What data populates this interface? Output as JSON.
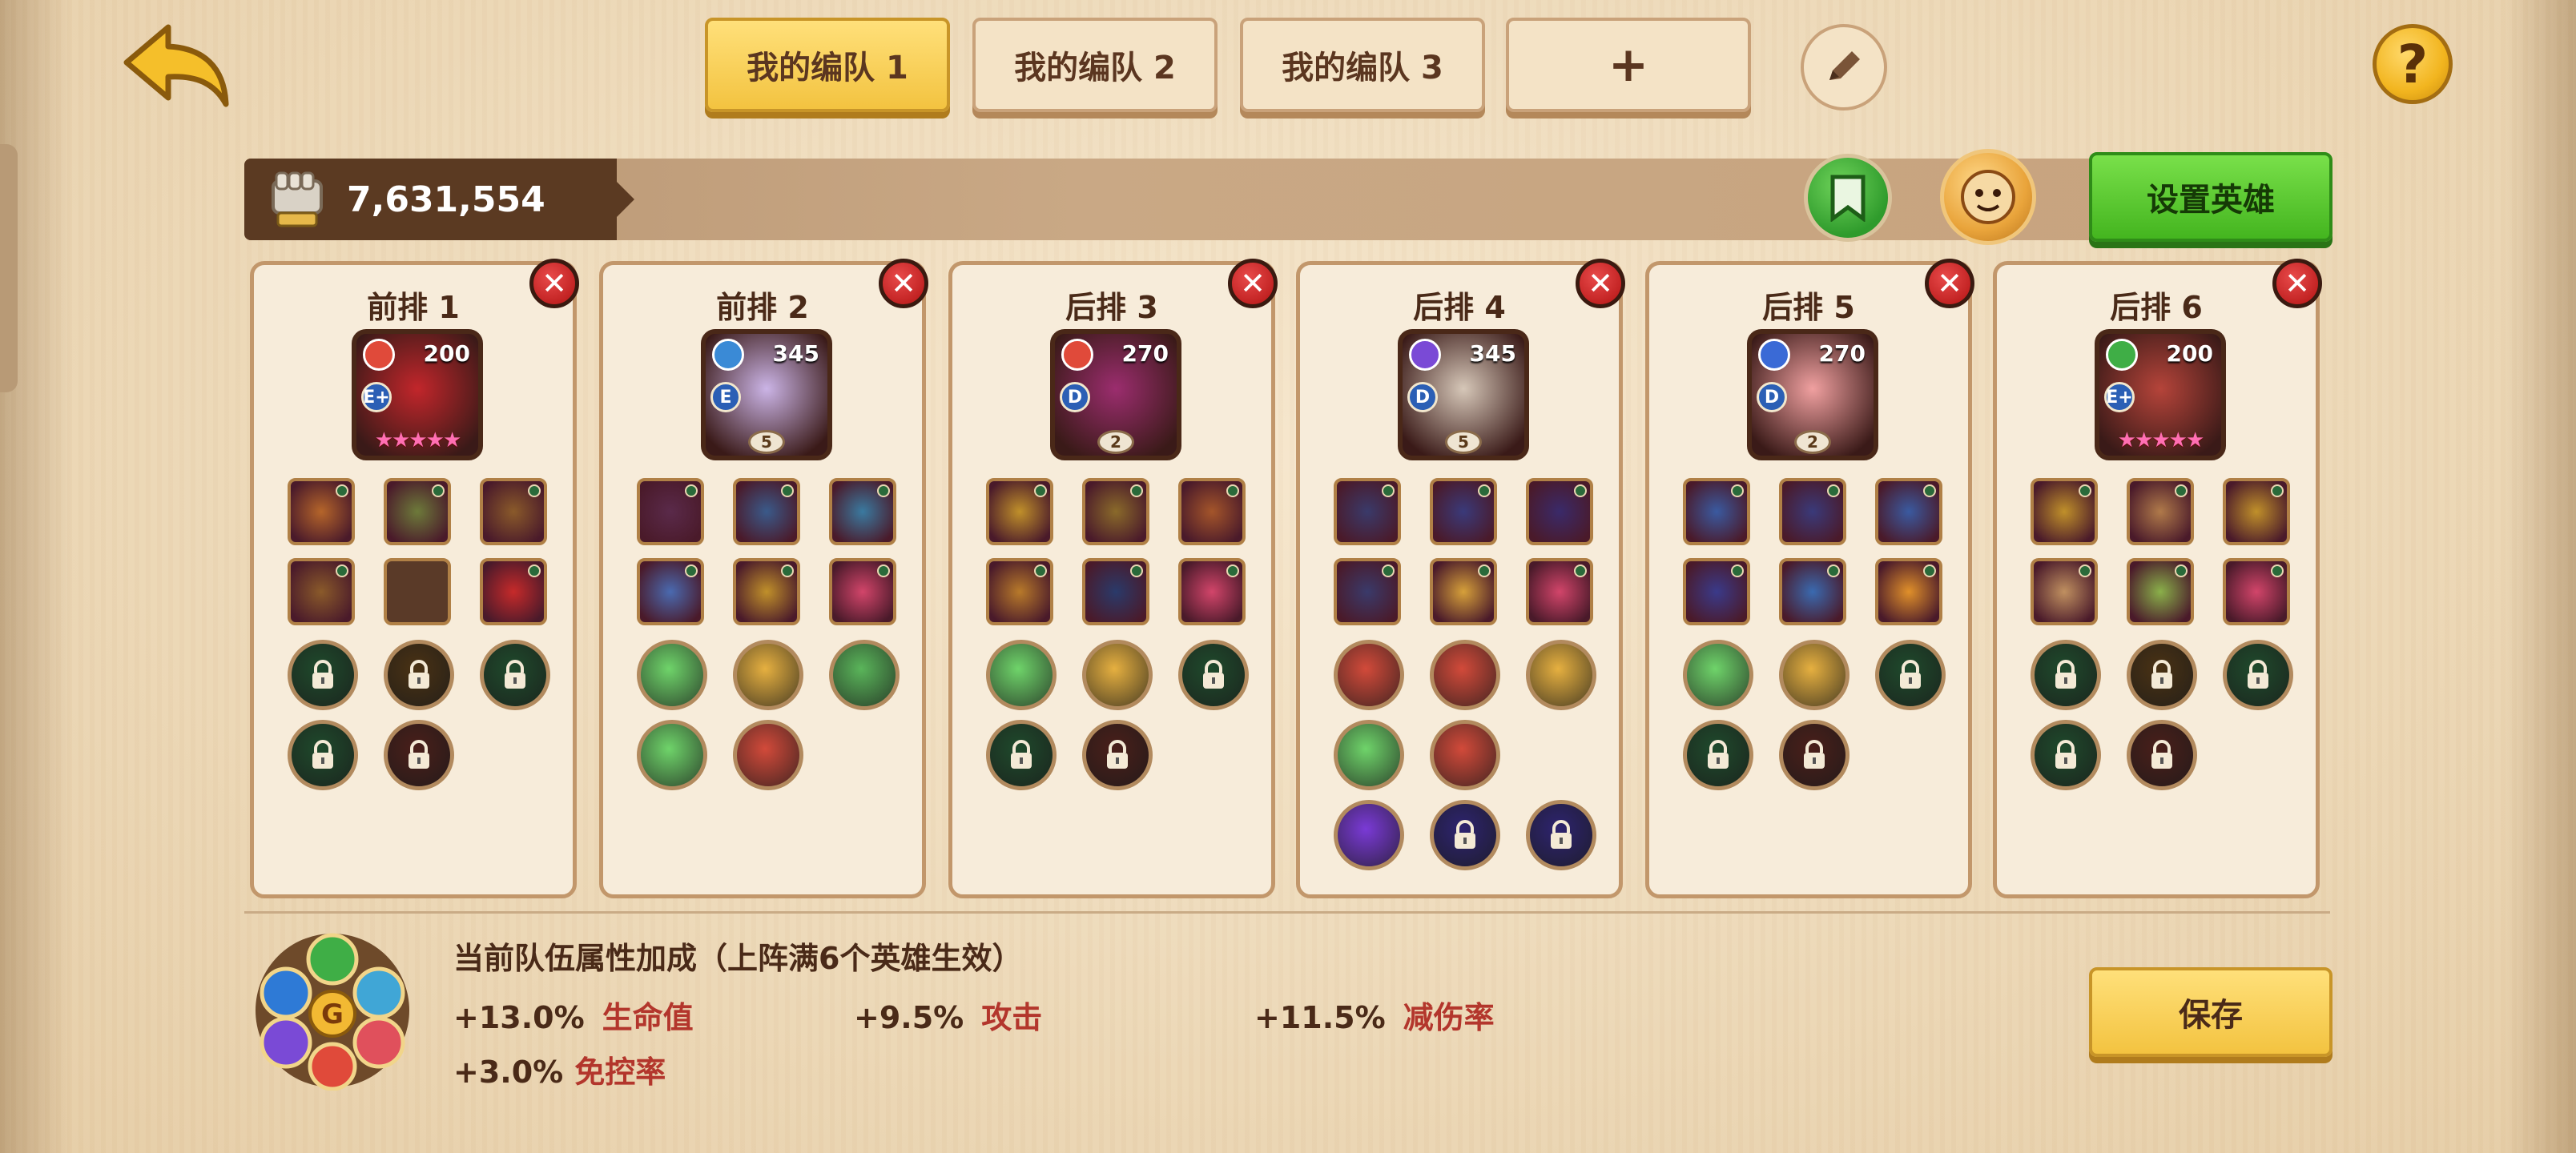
{
  "tabs": [
    {
      "label": "我的编队 1",
      "active": true
    },
    {
      "label": "我的编队 2",
      "active": false
    },
    {
      "label": "我的编队 3",
      "active": false
    },
    {
      "label": "+",
      "active": false
    }
  ],
  "help_label": "?",
  "power": {
    "value": "7,631,554"
  },
  "set_hero_label": "设置英雄",
  "save_label": "保存",
  "close_symbol": "✕",
  "slots": [
    {
      "title": "前排 1",
      "level": "200",
      "grade": "E+",
      "stars": "★★★★★",
      "portrait_color": "#c2262b"
    },
    {
      "title": "前排 2",
      "level": "345",
      "grade": "E",
      "tier": "5",
      "portrait_color": "#cbb4e6"
    },
    {
      "title": "后排 3",
      "level": "270",
      "grade": "D",
      "tier": "2",
      "portrait_color": "#9b2d6e"
    },
    {
      "title": "后排 4",
      "level": "345",
      "grade": "D",
      "tier": "5",
      "portrait_color": "#d6c7b8"
    },
    {
      "title": "后排 5",
      "level": "270",
      "grade": "D",
      "tier": "2",
      "portrait_color": "#f0a0a0"
    },
    {
      "title": "后排 6",
      "level": "200",
      "grade": "E+",
      "stars": "★★★★★",
      "portrait_color": "#b5443a"
    }
  ],
  "team_bonus": {
    "title": "当前队伍属性加成（上阵满6个英雄生效）",
    "stats": [
      {
        "value": "+13.0%",
        "name": "生命值"
      },
      {
        "value": "+9.5%",
        "name": "攻击"
      },
      {
        "value": "+11.5%",
        "name": "减伤率"
      },
      {
        "value": "+3.0%",
        "name": "免控率"
      }
    ]
  }
}
